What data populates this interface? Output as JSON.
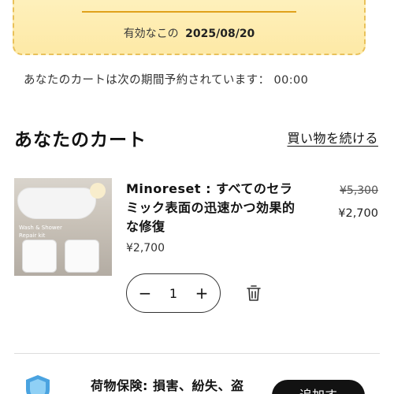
{
  "coupon": {
    "valid_label": "有効なこの",
    "valid_date": "2025/08/20"
  },
  "reservation": {
    "text": "あなたのカートは次の期間予約されています：",
    "time": "00:00"
  },
  "cart": {
    "title": "あなたのカート",
    "continue_label": "買い物を続ける"
  },
  "item": {
    "image_text": {
      "kit_line1": "Wash & Shower",
      "kit_line2": "Repair kit"
    },
    "name": "Minoreset : すべてのセラミック表面の迅速かつ効果的な修復",
    "unit_price": "¥2,700",
    "original_price": "¥5,300",
    "sale_price": "¥2,700",
    "quantity": "1",
    "minus_label": "−",
    "plus_label": "+"
  },
  "insurance": {
    "text": "荷物保険: 損害、紛失、盗",
    "button_label": "追加す"
  },
  "colors": {
    "coupon_bg": "#fde9a6",
    "coupon_border": "#e9c15a",
    "accent_line": "#e0a21c",
    "shield": "#4aa3e0",
    "button_bg": "#121212"
  }
}
